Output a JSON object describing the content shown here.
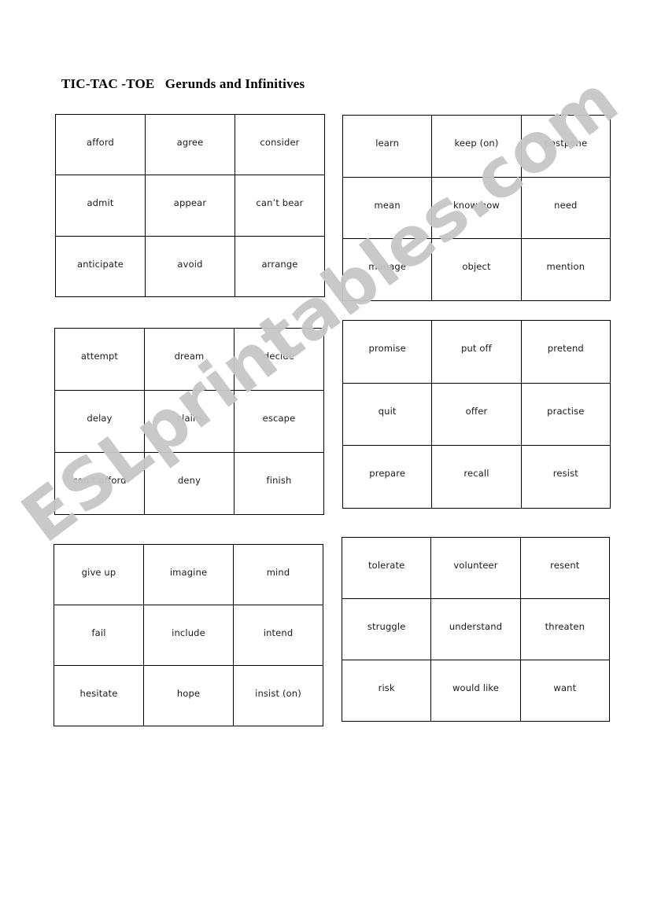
{
  "page": {
    "title": "TIC-TAC -TOE   Gerunds and Infinitives",
    "watermark": "ESLprintables.com",
    "watermark_color": "#c7c7c7",
    "text_color": "#1a1a1a",
    "border_color": "#000000",
    "background": "#ffffff"
  },
  "grids": [
    {
      "id": "grid-1",
      "cells": [
        "afford",
        "agree",
        "consider",
        "admit",
        "appear",
        "can’t bear",
        "anticipate",
        "avoid",
        "arrange"
      ]
    },
    {
      "id": "grid-2",
      "cells": [
        "learn",
        "keep (on)",
        "postpone",
        "mean",
        "know how",
        "need",
        "manage",
        "object",
        "mention"
      ]
    },
    {
      "id": "grid-3",
      "cells": [
        "attempt",
        "dream",
        "decide",
        "delay",
        "claim",
        "escape",
        "can’t afford",
        "deny",
        "finish"
      ]
    },
    {
      "id": "grid-4",
      "cells": [
        "promise",
        "put off",
        "pretend",
        "quit",
        "offer",
        "practise",
        "prepare",
        "recall",
        "resist"
      ]
    },
    {
      "id": "grid-5",
      "cells": [
        "give up",
        "imagine",
        "mind",
        "fail",
        "include",
        "intend",
        "hesitate",
        "hope",
        "insist (on)"
      ]
    },
    {
      "id": "grid-6",
      "cells": [
        "tolerate",
        "volunteer",
        "resent",
        "struggle",
        "understand",
        "threaten",
        "risk",
        "would like",
        "want"
      ]
    }
  ]
}
